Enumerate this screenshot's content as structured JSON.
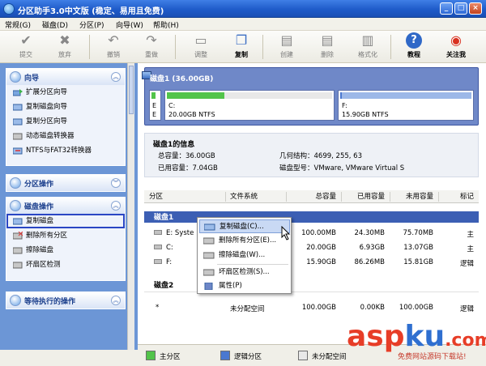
{
  "window": {
    "title": "分区助手3.0中文版 (稳定、易用且免费)"
  },
  "menu": [
    "常规(G)",
    "磁盘(D)",
    "分区(P)",
    "向导(W)",
    "帮助(H)"
  ],
  "toolbar": {
    "items": [
      {
        "label": "提交",
        "icon": "check-icon"
      },
      {
        "label": "放弃",
        "icon": "discard-icon"
      },
      {
        "label": "撤销",
        "icon": "undo-icon"
      },
      {
        "label": "重做",
        "icon": "redo-icon"
      },
      {
        "label": "调整",
        "icon": "resize-icon"
      },
      {
        "label": "复制",
        "icon": "copy-icon"
      },
      {
        "label": "创建",
        "icon": "create-icon"
      },
      {
        "label": "删除",
        "icon": "delete-icon"
      },
      {
        "label": "格式化",
        "icon": "format-icon"
      },
      {
        "label": "教程",
        "icon": "help-icon"
      },
      {
        "label": "关注我",
        "icon": "follow-icon"
      }
    ]
  },
  "sidebar": {
    "wizard": {
      "title": "向导",
      "items": [
        "扩展分区向导",
        "复制磁盘向导",
        "复制分区向导",
        "动态磁盘转换器",
        "NTFS与FAT32转换器"
      ]
    },
    "partition_ops": {
      "title": "分区操作"
    },
    "disk_ops": {
      "title": "磁盘操作",
      "items": [
        "复制磁盘",
        "删除所有分区",
        "擦除磁盘",
        "坏扇区检测"
      ]
    },
    "pending": {
      "title": "等待执行的操作"
    }
  },
  "disk_map": {
    "title": "磁盘1 (36.00GB)",
    "partitions": [
      {
        "letter": "E",
        "info": "E",
        "used_fraction": 0.5
      },
      {
        "letter": "C:",
        "info": "20.00GB NTFS",
        "used_fraction": 0.35
      },
      {
        "letter": "F:",
        "info": "15.90GB NTFS",
        "used_fraction": 0.01
      }
    ]
  },
  "disk_info": {
    "title": "磁盘1的信息",
    "total_label": "总容量：36.00GB",
    "used_label": "已用容量：7.04GB",
    "geometry_label": "几何结构：4699, 255, 63",
    "model_label": "磁盘型号：VMware, VMware Virtual S"
  },
  "table": {
    "headers": [
      "分区",
      "文件系统",
      "总容量",
      "已用容量",
      "未用容量",
      "标记"
    ],
    "groups": [
      {
        "name": "磁盘1",
        "rows": [
          {
            "part": "E:  Syste",
            "fs": "",
            "total": "100.00MB",
            "used": "24.30MB",
            "free": "75.70MB",
            "flag": "主"
          },
          {
            "part": "C:",
            "fs": "",
            "total": "20.00GB",
            "used": "6.93GB",
            "free": "13.07GB",
            "flag": "主"
          },
          {
            "part": "F:",
            "fs": "",
            "total": "15.90GB",
            "used": "86.26MB",
            "free": "15.81GB",
            "flag": "逻辑"
          }
        ]
      },
      {
        "name": "磁盘2",
        "rows": [
          {
            "part": "*",
            "fs": "未分配空间",
            "total": "100.00GB",
            "used": "0.00KB",
            "free": "100.00GB",
            "flag": "逻辑"
          }
        ]
      }
    ]
  },
  "context_menu": {
    "items": [
      "复制磁盘(C)...",
      "删除所有分区(E)...",
      "擦除磁盘(W)...",
      "坏扇区检测(S)...",
      "属性(P)"
    ]
  },
  "legend": [
    "主分区",
    "逻辑分区",
    "未分配空间"
  ],
  "watermark": {
    "brand_a": "asp",
    "brand_b": "ku",
    "brand_c": ".com",
    "sub": "免费网站源码下载站!"
  },
  "colors": {
    "accent": "#3c5fb4",
    "primary_partition": "#52c44a",
    "logical_partition": "#4a78d0",
    "unallocated": "#e8e8e8"
  }
}
